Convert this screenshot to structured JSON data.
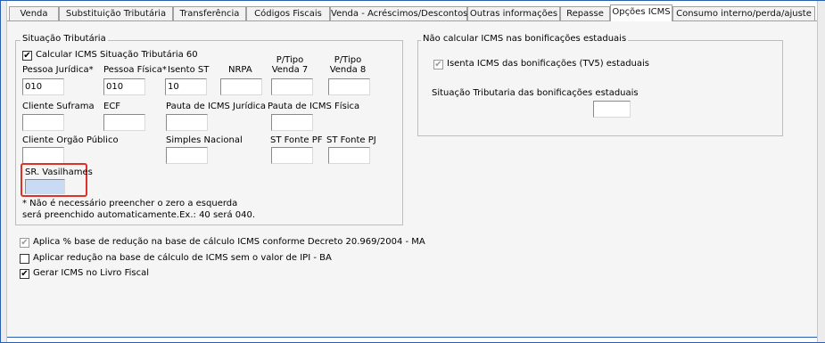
{
  "tabs": [
    {
      "label": "Venda",
      "active": false
    },
    {
      "label": "Substituição Tributária",
      "active": false
    },
    {
      "label": "Transferência",
      "active": false
    },
    {
      "label": "Códigos Fiscais",
      "active": false
    },
    {
      "label": "Venda - Acréscimos/Descontos",
      "active": false
    },
    {
      "label": "Outras informações",
      "active": false
    },
    {
      "label": "Repasse",
      "active": false
    },
    {
      "label": "Opções ICMS",
      "active": true
    },
    {
      "label": "Consumo interno/perda/ajuste",
      "active": false
    }
  ],
  "situacao": {
    "legend": "Situação Tributária",
    "calc_check_label": "Calcular ICMS Situação Tributária 60",
    "calc_checked": true,
    "fields": {
      "pj": {
        "label": "Pessoa Jurídica*",
        "value": "010"
      },
      "pf": {
        "label": "Pessoa Física*",
        "value": "010"
      },
      "isento": {
        "label": "Isento ST",
        "value": "10"
      },
      "nrpa": {
        "label": "NRPA",
        "value": ""
      },
      "ptv7": {
        "label1": "P/Tipo",
        "label2": "Venda 7",
        "value": ""
      },
      "ptv8": {
        "label1": "P/Tipo",
        "label2": "Venda 8",
        "value": ""
      },
      "suframa": {
        "label": "Cliente Suframa",
        "value": ""
      },
      "ecf": {
        "label": "ECF",
        "value": ""
      },
      "pauta_j": {
        "label": "Pauta de ICMS Jurídica",
        "value": ""
      },
      "pauta_f": {
        "label": "Pauta de ICMS Física",
        "value": ""
      },
      "orgao": {
        "label": "Cliente Orgão Público",
        "value": ""
      },
      "simples": {
        "label": "Simples Nacional",
        "value": ""
      },
      "st_pf": {
        "label": "ST Fonte PF",
        "value": ""
      },
      "st_pj": {
        "label": "ST Fonte PJ",
        "value": ""
      },
      "vasilhames": {
        "label": "SR. Vasilhames",
        "value": ""
      }
    },
    "note_line1": "* Não é necessário preencher o zero a esquerda",
    "note_line2": "será preenchido automaticamente.Ex.: 40 será 040."
  },
  "bonificacoes": {
    "legend": "Não calcular ICMS nas bonificações estaduais",
    "isenta_label": "Isenta ICMS das bonificações (TV5) estaduais",
    "isenta_checked": true,
    "situacao_label": "Situação Tributaria das  bonificações estaduais",
    "situacao_value": ""
  },
  "options": [
    {
      "label": "Aplica % base de redução na base de cálculo ICMS conforme Decreto 20.969/2004 - MA",
      "checked": true,
      "disabled": true
    },
    {
      "label": "Aplicar redução na base de cálculo de ICMS sem o valor de IPI - BA",
      "checked": false,
      "disabled": false
    },
    {
      "label": "Gerar ICMS no Livro Fiscal",
      "checked": true,
      "disabled": false
    }
  ],
  "colors": {
    "frame": "#2a5fb0",
    "highlight": "#e0302a",
    "selected_field": "#c9dbf4"
  }
}
